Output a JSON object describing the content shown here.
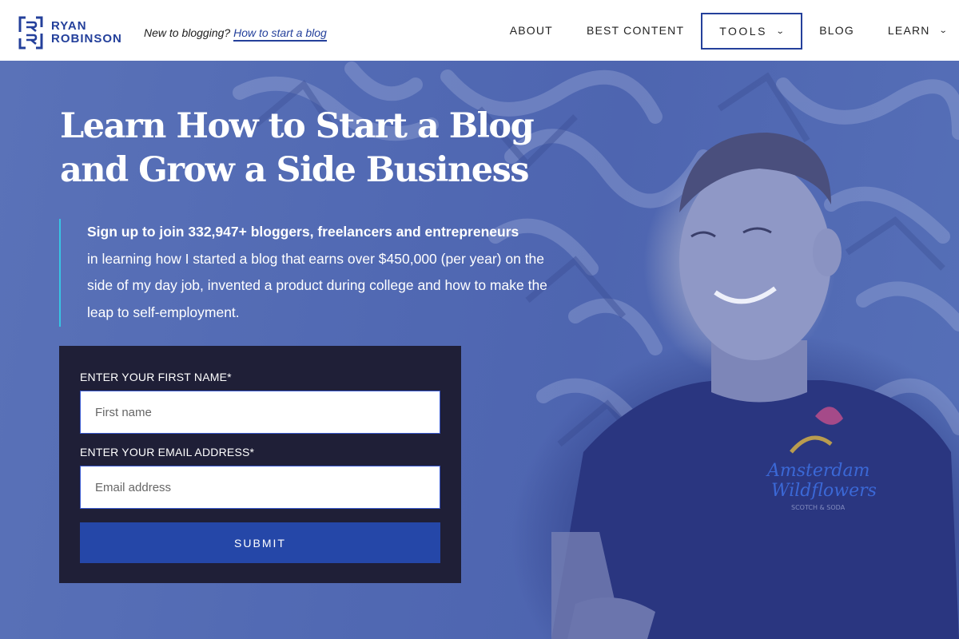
{
  "header": {
    "logo": {
      "line1": "RYAN",
      "line2": "ROBINSON"
    },
    "tagline_prefix": "New to blogging?",
    "tagline_link": "How to start a blog",
    "nav": [
      {
        "label": "ABOUT",
        "has_dropdown": false
      },
      {
        "label": "BEST CONTENT",
        "has_dropdown": false
      },
      {
        "label": "TOOLS",
        "has_dropdown": true,
        "active": true
      },
      {
        "label": "BLOG",
        "has_dropdown": false
      },
      {
        "label": "LEARN",
        "has_dropdown": true
      }
    ],
    "chevron": "⌄"
  },
  "hero": {
    "title_line1": "Learn How to Start a Blog",
    "title_line2": "and Grow a Side Business",
    "intro_bold": "Sign up to join 332,947+ bloggers, freelancers and entrepreneurs",
    "intro_rest": "in learning how I started a blog that earns over $450,000 (per year) on the side of my day job, invented a product during college and how to make the leap to self-employment.",
    "image_alt": "Ryan Robinson smiling at laptop in front of graffiti mural"
  },
  "form": {
    "first_name_label": "ENTER YOUR FIRST NAME*",
    "first_name_placeholder": "First name",
    "first_name_value": "",
    "email_label": "ENTER YOUR EMAIL ADDRESS*",
    "email_placeholder": "Email address",
    "email_value": "",
    "submit_label": "SUBMIT"
  },
  "colors": {
    "brand_blue": "#24409b",
    "accent_cyan": "#37c4e3",
    "form_bg": "#1f1f37",
    "button_bg": "#2547a8",
    "hero_overlay": "#5a72b8"
  }
}
